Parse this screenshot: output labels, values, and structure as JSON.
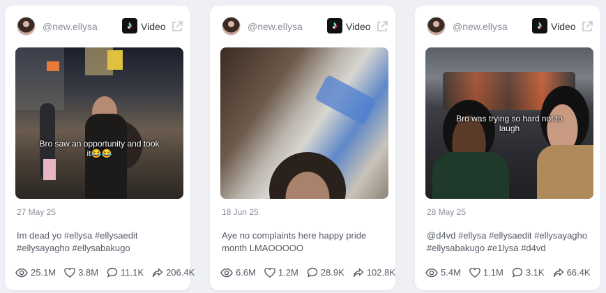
{
  "cards": [
    {
      "handle": "@new.ellysa",
      "type_label": "Video",
      "thumbnail_caption": "Bro saw an opportunity and took it😂😂",
      "date": "27 May 25",
      "description": "Im dead yo #ellysa #ellysaedit #ellysayagho #ellysabakugo",
      "stats": {
        "views": "25.1M",
        "likes": "3.8M",
        "comments": "11.1K",
        "shares": "206.4K"
      }
    },
    {
      "handle": "@new.ellysa",
      "type_label": "Video",
      "thumbnail_caption": "",
      "date": "18 Jun 25",
      "description": "Aye no complaints here happy pride month LMAOOOOO",
      "stats": {
        "views": "6.6M",
        "likes": "1.2M",
        "comments": "28.9K",
        "shares": "102.8K"
      }
    },
    {
      "handle": "@new.ellysa",
      "type_label": "Video",
      "thumbnail_caption": "Bro was trying so hard not to laugh",
      "date": "28 May 25",
      "description": "@d4vd #ellysa #ellysaedit #ellysayagho #ellysabakugo #e1lysa #d4vd",
      "stats": {
        "views": "5.4M",
        "likes": "1.1M",
        "comments": "3.1K",
        "shares": "66.4K"
      }
    }
  ],
  "icons": {
    "platform": "tiktok-icon",
    "external": "external-link-icon",
    "views": "eye-icon",
    "likes": "heart-icon",
    "comments": "comment-icon",
    "shares": "share-icon"
  }
}
